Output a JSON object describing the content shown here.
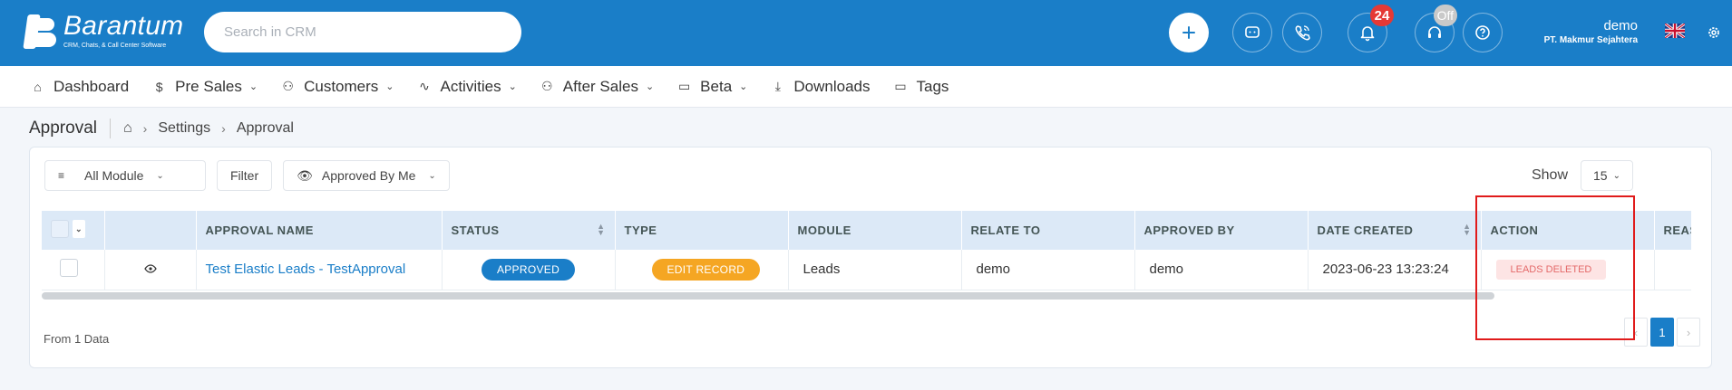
{
  "brand": {
    "name": "Barantum",
    "tagline": "CRM, Chats, & Call Center Software"
  },
  "search": {
    "placeholder": "Search in CRM"
  },
  "header": {
    "notification_count": "24",
    "status_badge": "Off",
    "user_name": "demo",
    "user_company": "PT. Makmur Sejahtera"
  },
  "nav": [
    {
      "label": "Dashboard",
      "icon": "home-icon"
    },
    {
      "label": "Pre Sales",
      "icon": "dollar-icon",
      "dropdown": true
    },
    {
      "label": "Customers",
      "icon": "users-icon",
      "dropdown": true
    },
    {
      "label": "Activities",
      "icon": "activity-icon",
      "dropdown": true
    },
    {
      "label": "After Sales",
      "icon": "users-icon",
      "dropdown": true
    },
    {
      "label": "Beta",
      "icon": "folder-icon",
      "dropdown": true
    },
    {
      "label": "Downloads",
      "icon": "download-icon"
    },
    {
      "label": "Tags",
      "icon": "folder-icon"
    }
  ],
  "breadcrumb": {
    "title": "Approval",
    "items": [
      "Settings",
      "Approval"
    ]
  },
  "filters": {
    "module": "All Module",
    "filter": "Filter",
    "approved_by": "Approved By Me",
    "show_label": "Show",
    "show_value": "15"
  },
  "table": {
    "columns": [
      "",
      "",
      "APPROVAL NAME",
      "STATUS",
      "TYPE",
      "MODULE",
      "RELATE TO",
      "APPROVED BY",
      "DATE CREATED",
      "ACTION",
      "REASON"
    ],
    "rows": [
      {
        "approval_name": "Test Elastic Leads - TestApproval",
        "status": "APPROVED",
        "type": "EDIT RECORD",
        "module": "Leads",
        "relate_to": "demo",
        "approved_by": "demo",
        "date_created": "2023-06-23 13:23:24",
        "action": "LEADS DELETED",
        "reason": ""
      }
    ]
  },
  "footer": {
    "count_text": "From 1 Data",
    "current_page": "1",
    "prev": "‹",
    "next": "›"
  },
  "colors": {
    "primary": "#1a7ec8",
    "warning": "#f5a623",
    "danger": "#e53935"
  }
}
